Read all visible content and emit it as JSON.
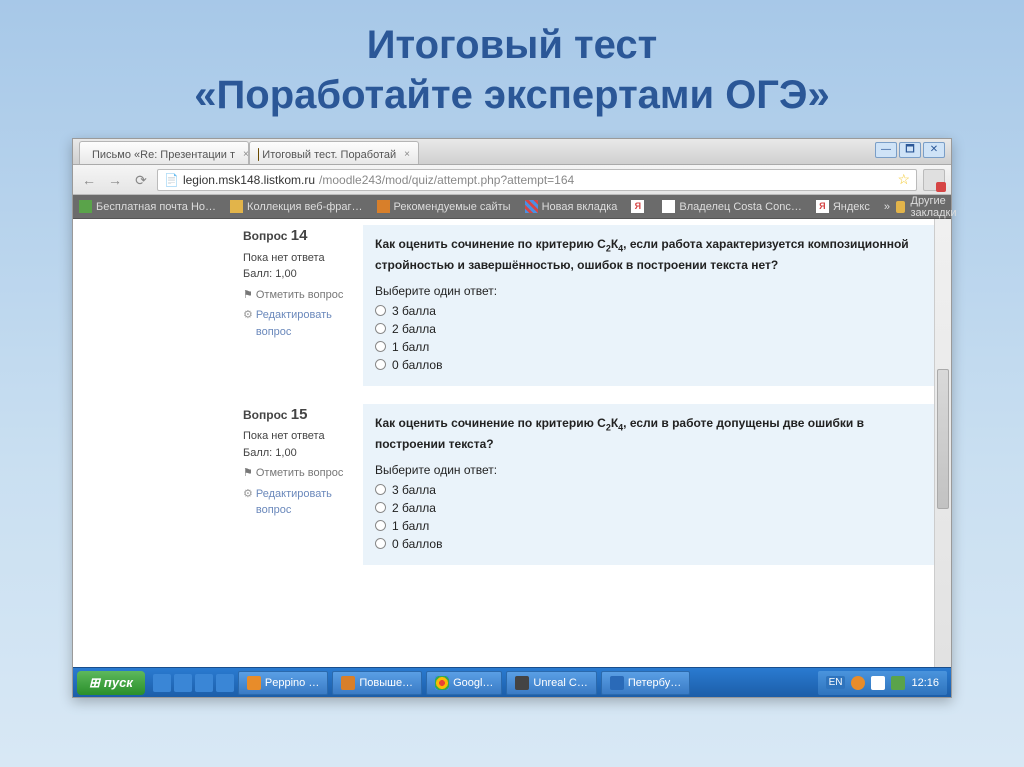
{
  "slide": {
    "title_line1": "Итоговый тест",
    "title_line2": "«Поработайте экспертами ОГЭ»"
  },
  "window": {
    "controls": {
      "min": "—",
      "max": "🗖",
      "close": "✕"
    }
  },
  "tabs": [
    {
      "label": "Письмо «Re: Презентации т",
      "close": "×"
    },
    {
      "label": "Итоговый тест. Поработай",
      "close": "×"
    }
  ],
  "address": {
    "host": "legion.msk148.listkom.ru",
    "path": "/moodle243/mod/quiz/attempt.php?attempt=164",
    "doc_icon": "📄"
  },
  "bookmarks": {
    "items": [
      "Бесплатная почта Но…",
      "Коллекция веб-фраг…",
      "Рекомендуемые сайты",
      "Новая вкладка",
      "",
      "Владелец Costa Conc…",
      "Яндекс"
    ],
    "more": "»",
    "other": "Другие закладки"
  },
  "quiz": {
    "q14": {
      "label": "Вопрос",
      "num": "14",
      "no_answer": "Пока нет ответа",
      "score": "Балл: 1,00",
      "flag": "Отметить вопрос",
      "edit": "Редактировать вопрос",
      "text_a": "Как оценить сочинение по критерию С",
      "text_b": "К",
      "text_c": ", если работа  характеризуется композиционной  стройностью и завершённостью, ошибок в построении текста нет?",
      "sub2": "2",
      "sub4": "4",
      "prompt": "Выберите один ответ:",
      "options": [
        "3 балла",
        "2 балла",
        "1 балл",
        "0 баллов"
      ]
    },
    "q15": {
      "label": "Вопрос",
      "num": "15",
      "no_answer": "Пока нет ответа",
      "score": "Балл: 1,00",
      "flag": "Отметить вопрос",
      "edit": "Редактировать вопрос",
      "text_a": "Как оценить сочинение по критерию С",
      "text_b": "К",
      "text_c": ", если в работе допущены две ошибки в построении текста?",
      "sub2": "2",
      "sub4": "4",
      "prompt": "Выберите один ответ:",
      "options": [
        "3 балла",
        "2 балла",
        "1 балл",
        "0 баллов"
      ]
    }
  },
  "taskbar": {
    "start": "пуск",
    "tasks": [
      "Peppino …",
      "Повыше…",
      "Googl…",
      "Unreal C…",
      "Петербу…"
    ],
    "lang": "EN",
    "clock": "12:16"
  },
  "icons": {
    "ya": "Я"
  }
}
